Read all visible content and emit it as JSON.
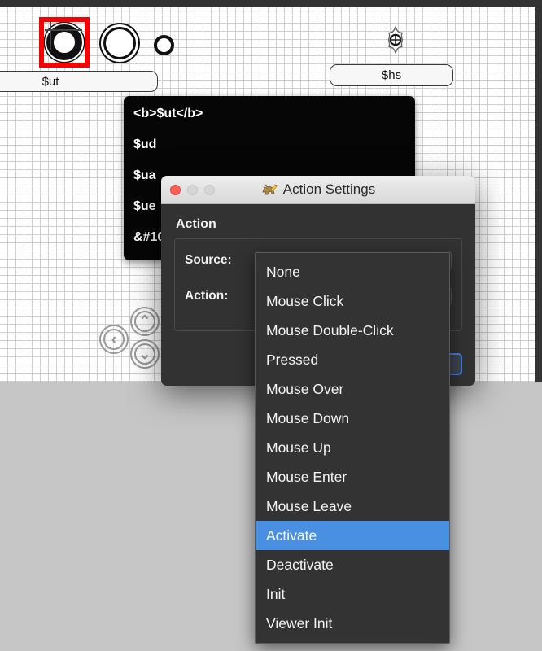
{
  "canvas": {
    "widgets": [
      {
        "name": "ring-large",
        "label": ""
      },
      {
        "name": "ring-medium",
        "label": ""
      },
      {
        "name": "ring-small",
        "label": ""
      },
      {
        "name": "compass",
        "label": ""
      }
    ],
    "fields": {
      "ut_value": "$ut",
      "hs_value": "$hs"
    },
    "nav": {
      "left": "‹",
      "up": "⌃",
      "down": "⌄"
    },
    "selection_color": "#fb0000"
  },
  "tooltip": {
    "lines": [
      "<b>$ut</b>",
      "$ud",
      "$ua",
      "$ue",
      "",
      "&#10"
    ]
  },
  "dialog": {
    "title": "Action Settings",
    "app_icon": "dog-pencil-icon",
    "traffic_lights": {
      "close": "close-button",
      "minimize": "minimize-button",
      "maximize": "maximize-button"
    },
    "section_title": "Action",
    "fields": [
      {
        "label": "Source:",
        "value": ""
      },
      {
        "label": "Action:",
        "value": ""
      }
    ],
    "ok_button_label": "",
    "accent_color": "#3f7fd8"
  },
  "dropdown": {
    "selected": "Activate",
    "highlight_color": "#4a90e2",
    "items": [
      "None",
      "Mouse Click",
      "Mouse Double-Click",
      "Pressed",
      "Mouse Over",
      "Mouse Down",
      "Mouse Up",
      "Mouse Enter",
      "Mouse Leave",
      "Activate",
      "Deactivate",
      "Init",
      "Viewer Init"
    ]
  }
}
